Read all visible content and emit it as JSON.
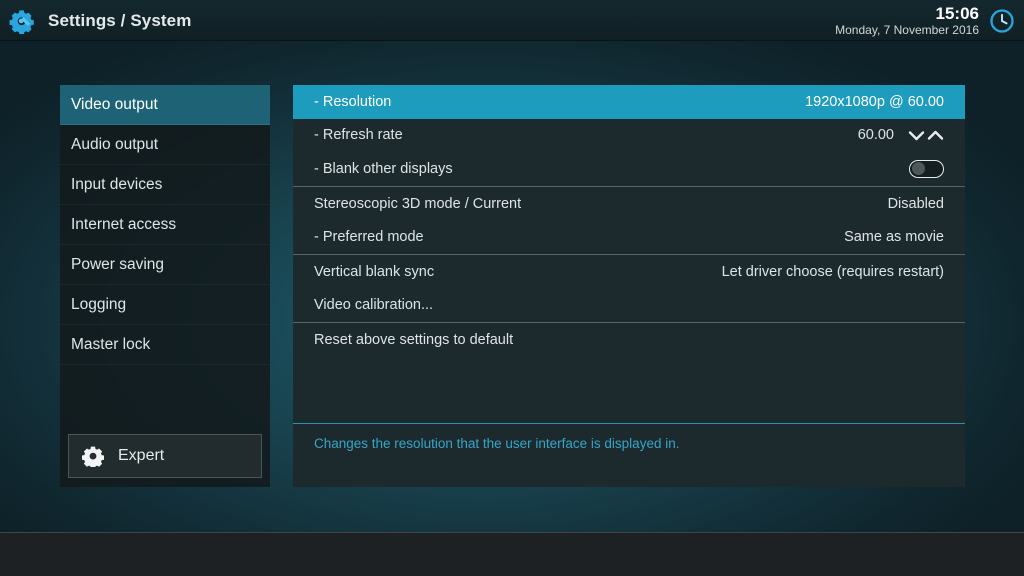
{
  "header": {
    "logo_icon": "settings-gear-wrench-icon",
    "title": "Settings / System",
    "clock": {
      "time": "15:06",
      "date": "Monday, 7 November 2016",
      "icon": "clock-icon"
    }
  },
  "sidebar": {
    "items": [
      {
        "label": "Video output",
        "selected": true
      },
      {
        "label": "Audio output",
        "selected": false
      },
      {
        "label": "Input devices",
        "selected": false
      },
      {
        "label": "Internet access",
        "selected": false
      },
      {
        "label": "Power saving",
        "selected": false
      },
      {
        "label": "Logging",
        "selected": false
      },
      {
        "label": "Master lock",
        "selected": false
      }
    ],
    "expert_button": {
      "label": "Expert",
      "icon": "gear-icon"
    }
  },
  "content": {
    "groups": [
      {
        "rows": [
          {
            "label": "- Resolution",
            "value": "1920x1080p  @ 60.00",
            "selected": true,
            "control": "none"
          },
          {
            "label": "- Refresh rate",
            "value": "60.00",
            "selected": false,
            "control": "spinner"
          },
          {
            "label": "- Blank other displays",
            "value": "",
            "selected": false,
            "control": "toggle",
            "toggle_on": false
          }
        ]
      },
      {
        "rows": [
          {
            "label": "Stereoscopic 3D mode / Current",
            "value": "Disabled",
            "selected": false,
            "control": "none"
          },
          {
            "label": "- Preferred mode",
            "value": "Same as movie",
            "selected": false,
            "control": "none"
          }
        ]
      },
      {
        "rows": [
          {
            "label": "Vertical blank sync",
            "value": "Let driver choose (requires restart)",
            "selected": false,
            "control": "none"
          },
          {
            "label": "Video calibration...",
            "value": "",
            "selected": false,
            "control": "none"
          }
        ]
      },
      {
        "rows": [
          {
            "label": "Reset above settings to default",
            "value": "",
            "selected": false,
            "control": "none"
          }
        ]
      }
    ],
    "description": "Changes the resolution that the user interface is displayed in."
  },
  "colors": {
    "sidebar_selected": "#1d6375",
    "row_selected": "#1e9cbe",
    "description_text": "#36a5c8",
    "panel_background": "#1d2a2d",
    "accent": "#2c8fb0"
  }
}
